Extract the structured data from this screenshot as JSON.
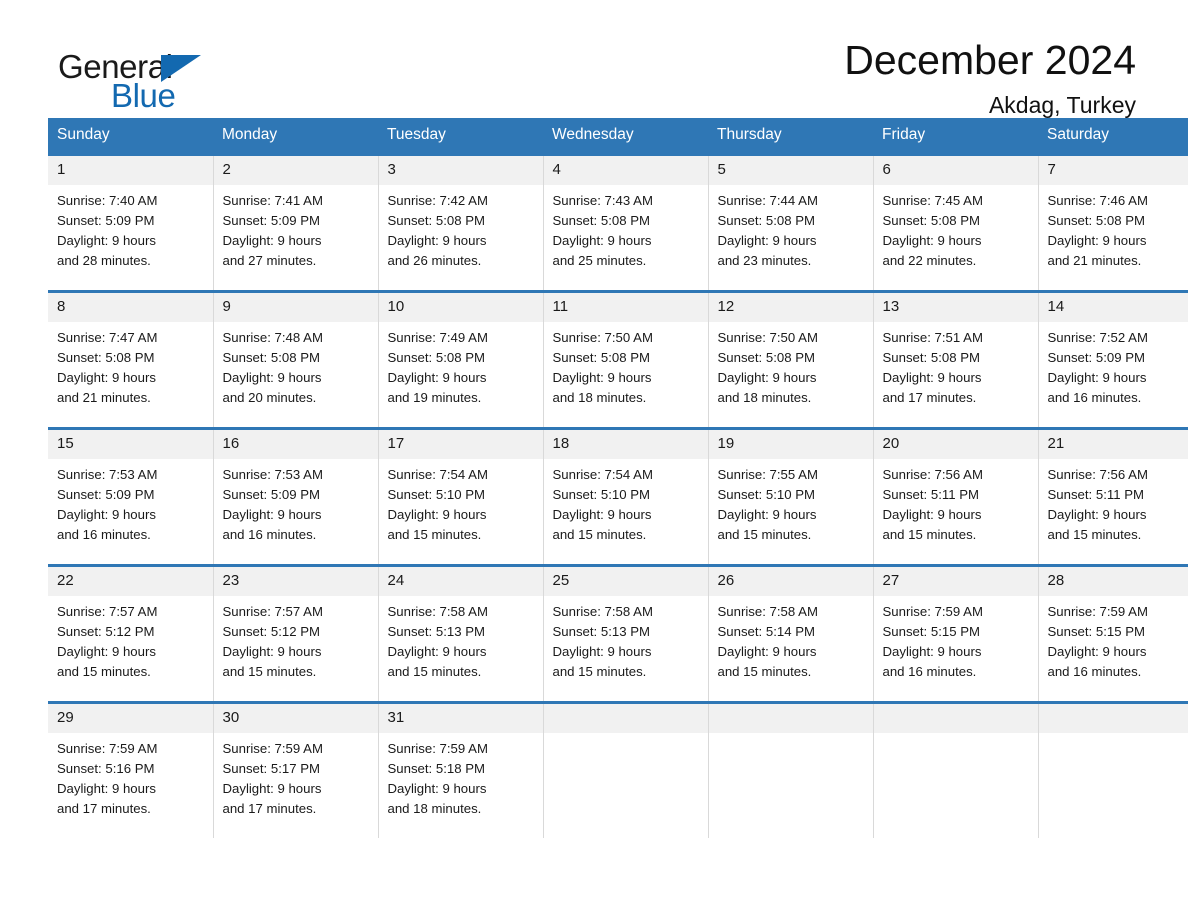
{
  "brand": {
    "word1": "General",
    "word2": "Blue",
    "accent_color": "#1369b0",
    "triangle_icon": "triangle-icon"
  },
  "header": {
    "title": "December 2024",
    "subtitle": "Akdag, Turkey"
  },
  "theme": {
    "header_row_bg": "#2f77b5",
    "day_number_bg": "#f1f1f1",
    "row_divider": "#2f77b5",
    "page_bg": "#ffffff",
    "text": "#1a1a1a"
  },
  "calendar": {
    "weekday_headers": [
      "Sunday",
      "Monday",
      "Tuesday",
      "Wednesday",
      "Thursday",
      "Friday",
      "Saturday"
    ],
    "weeks": [
      [
        {
          "day": "1",
          "info": "Sunrise: 7:40 AM\nSunset: 5:09 PM\nDaylight: 9 hours\nand 28 minutes."
        },
        {
          "day": "2",
          "info": "Sunrise: 7:41 AM\nSunset: 5:09 PM\nDaylight: 9 hours\nand 27 minutes."
        },
        {
          "day": "3",
          "info": "Sunrise: 7:42 AM\nSunset: 5:08 PM\nDaylight: 9 hours\nand 26 minutes."
        },
        {
          "day": "4",
          "info": "Sunrise: 7:43 AM\nSunset: 5:08 PM\nDaylight: 9 hours\nand 25 minutes."
        },
        {
          "day": "5",
          "info": "Sunrise: 7:44 AM\nSunset: 5:08 PM\nDaylight: 9 hours\nand 23 minutes."
        },
        {
          "day": "6",
          "info": "Sunrise: 7:45 AM\nSunset: 5:08 PM\nDaylight: 9 hours\nand 22 minutes."
        },
        {
          "day": "7",
          "info": "Sunrise: 7:46 AM\nSunset: 5:08 PM\nDaylight: 9 hours\nand 21 minutes."
        }
      ],
      [
        {
          "day": "8",
          "info": "Sunrise: 7:47 AM\nSunset: 5:08 PM\nDaylight: 9 hours\nand 21 minutes."
        },
        {
          "day": "9",
          "info": "Sunrise: 7:48 AM\nSunset: 5:08 PM\nDaylight: 9 hours\nand 20 minutes."
        },
        {
          "day": "10",
          "info": "Sunrise: 7:49 AM\nSunset: 5:08 PM\nDaylight: 9 hours\nand 19 minutes."
        },
        {
          "day": "11",
          "info": "Sunrise: 7:50 AM\nSunset: 5:08 PM\nDaylight: 9 hours\nand 18 minutes."
        },
        {
          "day": "12",
          "info": "Sunrise: 7:50 AM\nSunset: 5:08 PM\nDaylight: 9 hours\nand 18 minutes."
        },
        {
          "day": "13",
          "info": "Sunrise: 7:51 AM\nSunset: 5:08 PM\nDaylight: 9 hours\nand 17 minutes."
        },
        {
          "day": "14",
          "info": "Sunrise: 7:52 AM\nSunset: 5:09 PM\nDaylight: 9 hours\nand 16 minutes."
        }
      ],
      [
        {
          "day": "15",
          "info": "Sunrise: 7:53 AM\nSunset: 5:09 PM\nDaylight: 9 hours\nand 16 minutes."
        },
        {
          "day": "16",
          "info": "Sunrise: 7:53 AM\nSunset: 5:09 PM\nDaylight: 9 hours\nand 16 minutes."
        },
        {
          "day": "17",
          "info": "Sunrise: 7:54 AM\nSunset: 5:10 PM\nDaylight: 9 hours\nand 15 minutes."
        },
        {
          "day": "18",
          "info": "Sunrise: 7:54 AM\nSunset: 5:10 PM\nDaylight: 9 hours\nand 15 minutes."
        },
        {
          "day": "19",
          "info": "Sunrise: 7:55 AM\nSunset: 5:10 PM\nDaylight: 9 hours\nand 15 minutes."
        },
        {
          "day": "20",
          "info": "Sunrise: 7:56 AM\nSunset: 5:11 PM\nDaylight: 9 hours\nand 15 minutes."
        },
        {
          "day": "21",
          "info": "Sunrise: 7:56 AM\nSunset: 5:11 PM\nDaylight: 9 hours\nand 15 minutes."
        }
      ],
      [
        {
          "day": "22",
          "info": "Sunrise: 7:57 AM\nSunset: 5:12 PM\nDaylight: 9 hours\nand 15 minutes."
        },
        {
          "day": "23",
          "info": "Sunrise: 7:57 AM\nSunset: 5:12 PM\nDaylight: 9 hours\nand 15 minutes."
        },
        {
          "day": "24",
          "info": "Sunrise: 7:58 AM\nSunset: 5:13 PM\nDaylight: 9 hours\nand 15 minutes."
        },
        {
          "day": "25",
          "info": "Sunrise: 7:58 AM\nSunset: 5:13 PM\nDaylight: 9 hours\nand 15 minutes."
        },
        {
          "day": "26",
          "info": "Sunrise: 7:58 AM\nSunset: 5:14 PM\nDaylight: 9 hours\nand 15 minutes."
        },
        {
          "day": "27",
          "info": "Sunrise: 7:59 AM\nSunset: 5:15 PM\nDaylight: 9 hours\nand 16 minutes."
        },
        {
          "day": "28",
          "info": "Sunrise: 7:59 AM\nSunset: 5:15 PM\nDaylight: 9 hours\nand 16 minutes."
        }
      ],
      [
        {
          "day": "29",
          "info": "Sunrise: 7:59 AM\nSunset: 5:16 PM\nDaylight: 9 hours\nand 17 minutes."
        },
        {
          "day": "30",
          "info": "Sunrise: 7:59 AM\nSunset: 5:17 PM\nDaylight: 9 hours\nand 17 minutes."
        },
        {
          "day": "31",
          "info": "Sunrise: 7:59 AM\nSunset: 5:18 PM\nDaylight: 9 hours\nand 18 minutes."
        },
        {
          "day": "",
          "info": ""
        },
        {
          "day": "",
          "info": ""
        },
        {
          "day": "",
          "info": ""
        },
        {
          "day": "",
          "info": ""
        }
      ]
    ]
  }
}
